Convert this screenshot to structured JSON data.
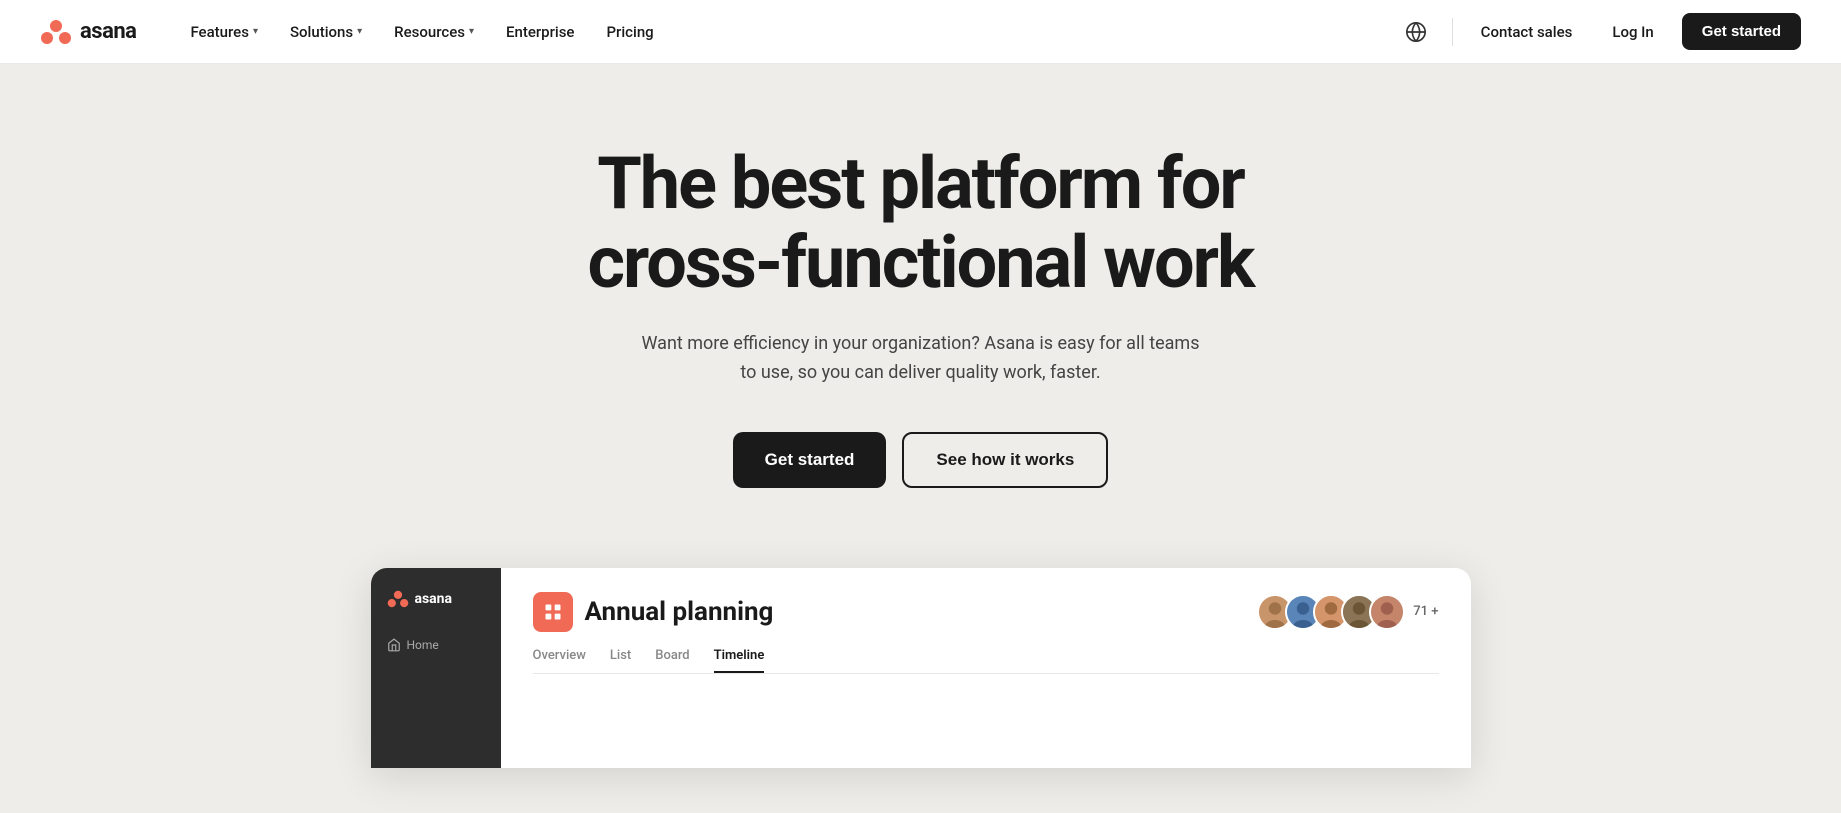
{
  "navbar": {
    "logo_text": "asana",
    "nav_items": [
      {
        "label": "Features",
        "has_dropdown": true
      },
      {
        "label": "Solutions",
        "has_dropdown": true
      },
      {
        "label": "Resources",
        "has_dropdown": true
      },
      {
        "label": "Enterprise",
        "has_dropdown": false
      },
      {
        "label": "Pricing",
        "has_dropdown": false
      }
    ],
    "contact_sales_label": "Contact sales",
    "login_label": "Log In",
    "get_started_label": "Get started"
  },
  "hero": {
    "title_line1": "The best platform for",
    "title_line2": "cross-functional work",
    "subtitle": "Want more efficiency in your organization? Asana is easy for all teams to use, so you can deliver quality work, faster.",
    "cta_primary": "Get started",
    "cta_secondary": "See how it works"
  },
  "preview": {
    "sidebar_logo": "asana",
    "sidebar_home": "Home",
    "project_icon": "📋",
    "project_title": "Annual planning",
    "avatar_count": "71 +",
    "tabs": [
      "Overview",
      "List",
      "Board",
      "Timeline"
    ]
  }
}
